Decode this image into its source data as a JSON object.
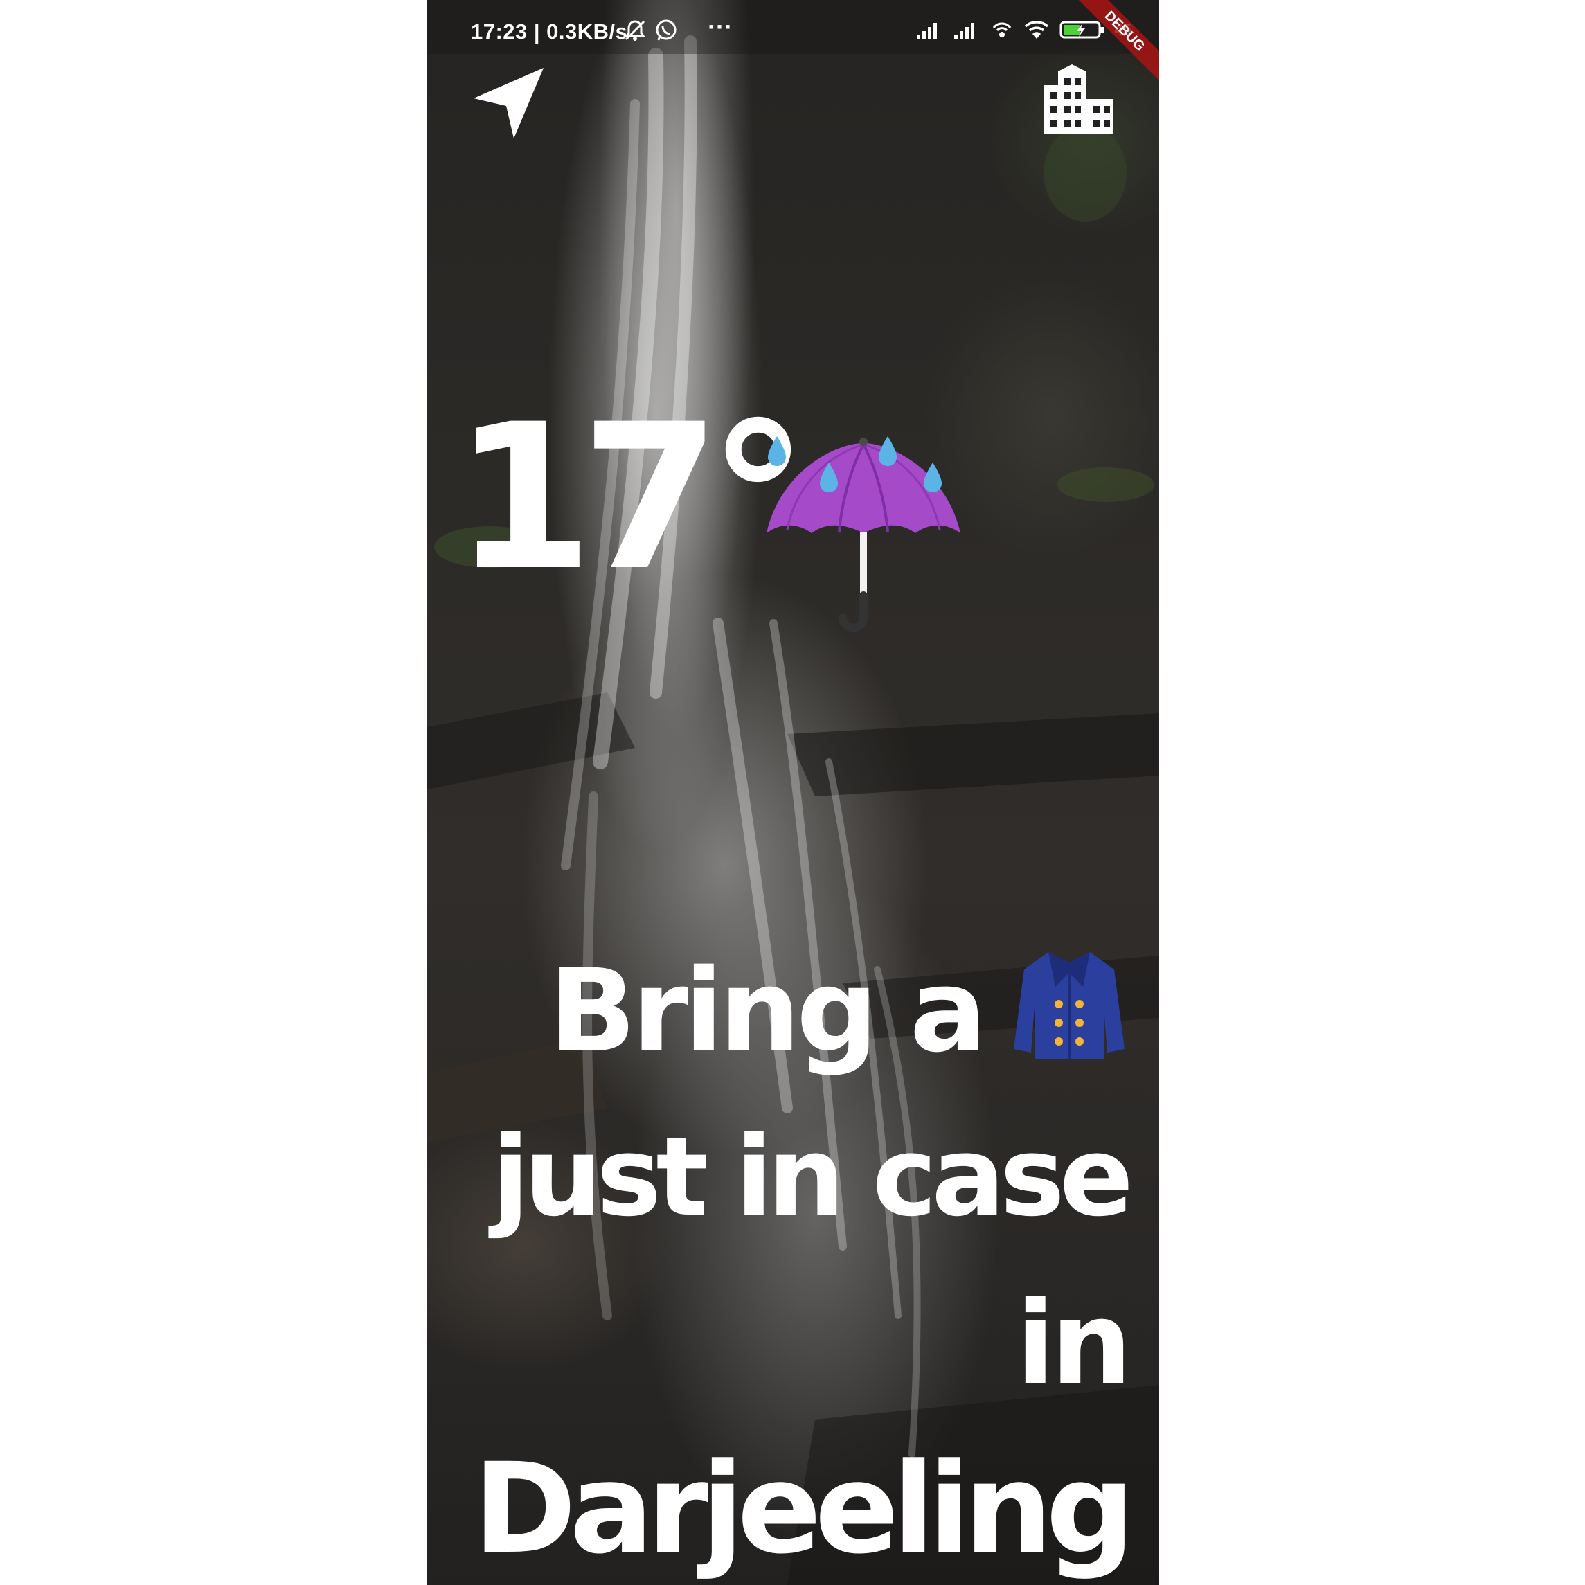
{
  "status_bar": {
    "time_speed": "17:23 | 0.3KB/s",
    "more_indicator": "···",
    "battery_text": "45",
    "debug_label": "DEBUG"
  },
  "weather": {
    "temperature": "17°",
    "condition_icon": "umbrella-with-rain-drops-icon"
  },
  "message": {
    "line1": "Bring a",
    "clothing_icon": "coat-icon",
    "line2": "just in case",
    "line3": "in",
    "line4": "Darjeeling"
  },
  "icons": {
    "location": "navigation-arrow-icon",
    "city": "city-building-icon"
  },
  "colors": {
    "text": "#ffffff",
    "umbrella": "#a54bc9",
    "rain_drop": "#5cb4e6",
    "coat": "#2b3f9e",
    "coat_buttons": "#f2b53a",
    "debug_ribbon": "#aa1414"
  }
}
